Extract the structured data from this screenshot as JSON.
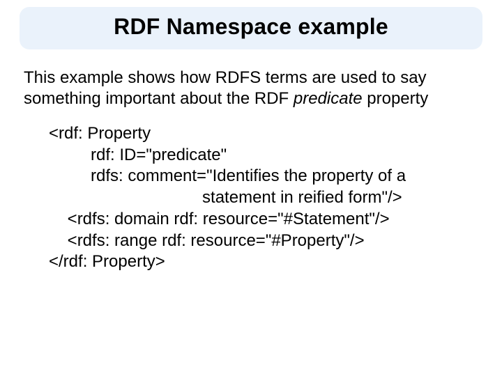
{
  "title": "RDF Namespace example",
  "body_pre": "This example shows how RDFS terms are used to say something important about the RDF ",
  "body_italic": "predicate",
  "body_post": " property",
  "code": "<rdf: Property\n         rdf: ID=\"predicate\"\n         rdfs: comment=\"Identifies the property of a\n                                 statement in reified form\"/>\n    <rdfs: domain rdf: resource=\"#Statement\"/>\n    <rdfs: range rdf: resource=\"#Property\"/>\n</rdf: Property>"
}
